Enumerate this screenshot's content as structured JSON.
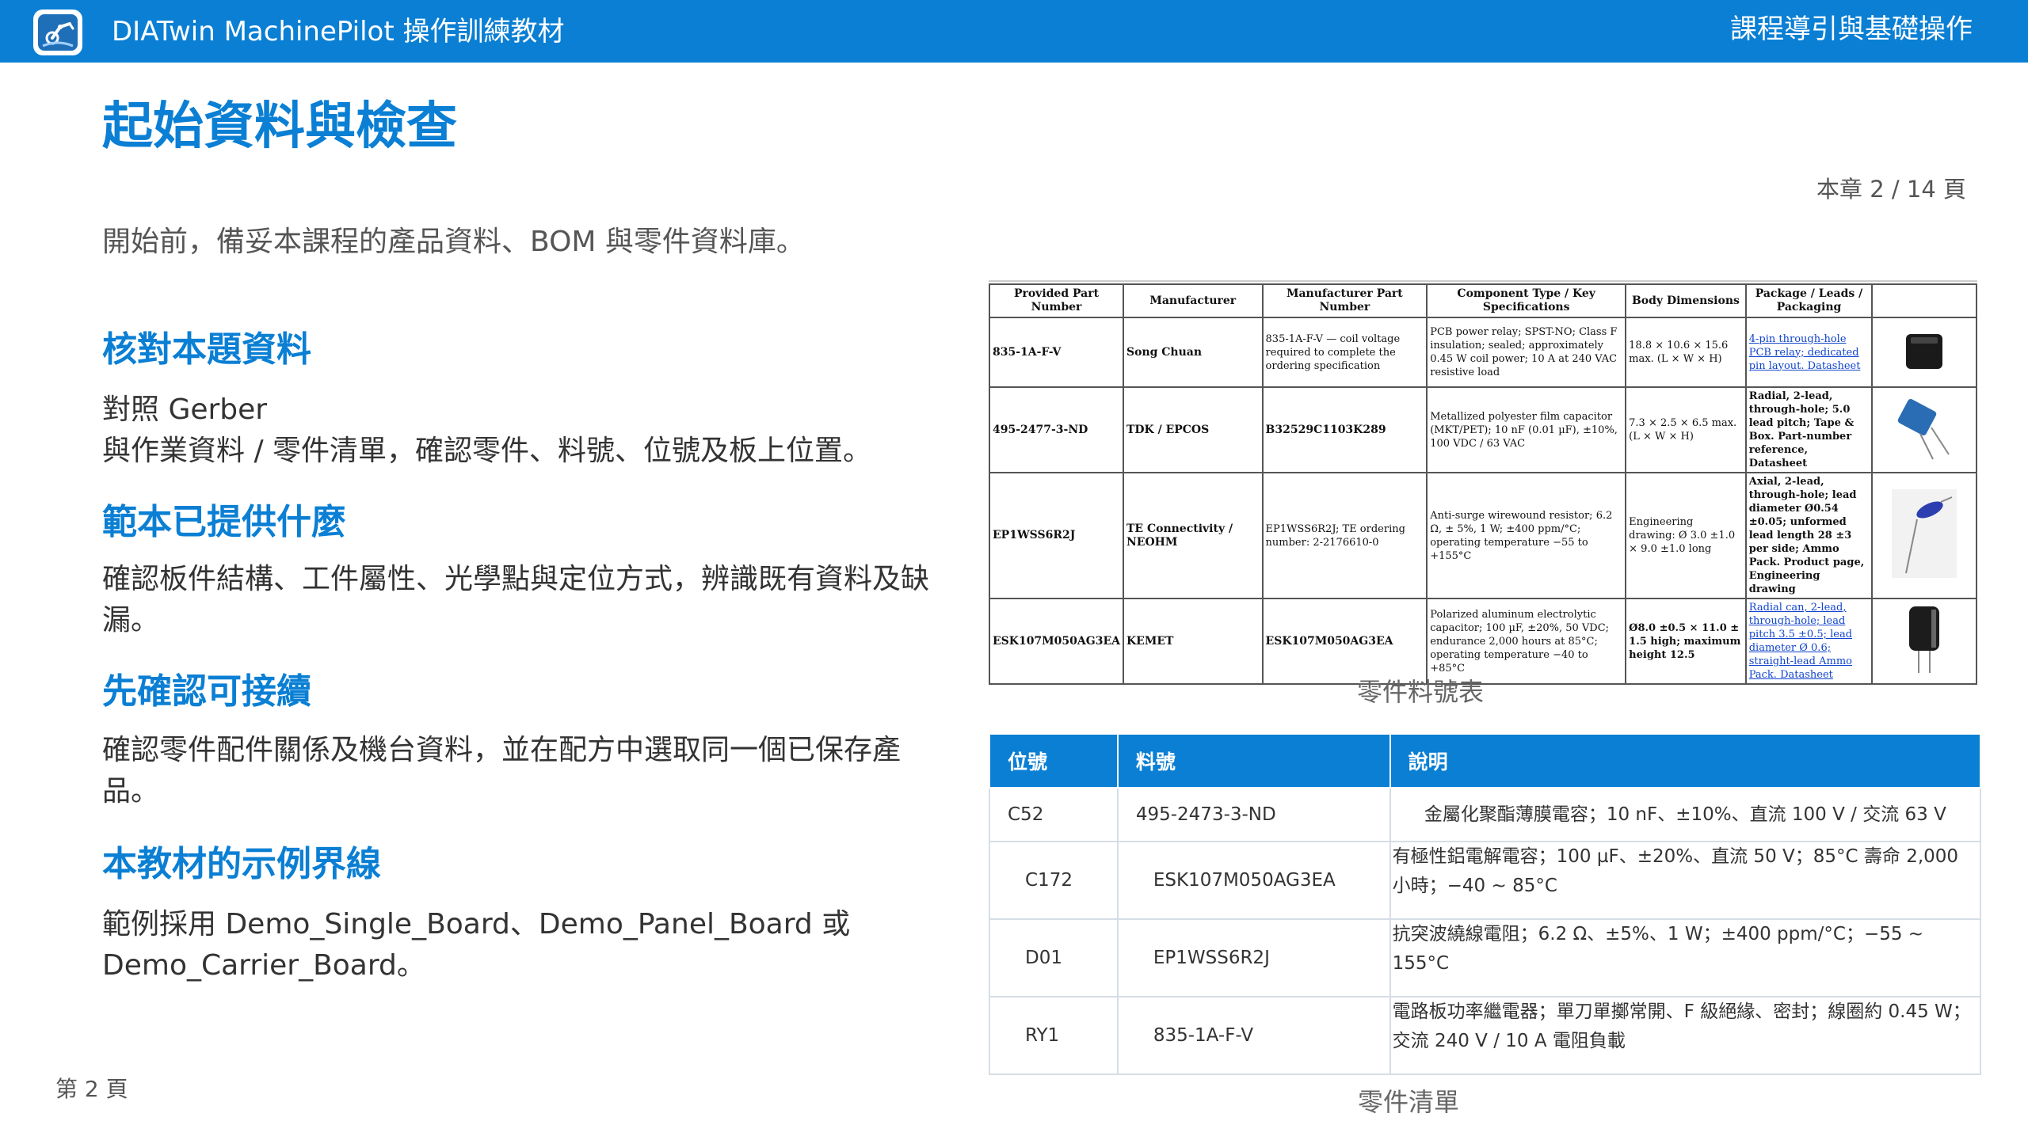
{
  "app": {
    "title": "DIATwin MachinePilot 操作訓練教材",
    "section_label": "課程導引與基礎操作",
    "icon": "robot-arm-icon",
    "accent_color": "#0a7fd4"
  },
  "page": {
    "title": "起始資料與檢查",
    "chapter_indicator": "本章 2 / 14 頁",
    "intro": "開始前，備妥本課程的產品資料、BOM 與零件資料庫。",
    "footer": "第 2 頁"
  },
  "sections": [
    {
      "heading": "核對本題資料",
      "body_line1": "對照 Gerber",
      "body_rest": "與作業資料 / 零件清單，確認零件、料號、位號及板上位置。"
    },
    {
      "heading": "範本已提供什麼",
      "body": "確認板件結構、工件屬性、光學點與定位方式，辨識既有資料及缺漏。"
    },
    {
      "heading": "先確認可接續",
      "body": "確認零件配件關係及機台資料，並在配方中選取同一個已保存產品。"
    },
    {
      "heading": "本教材的示例界線",
      "body": "範例採用 Demo_Single_Board、Demo_Panel_Board 或 Demo_Carrier_Board。"
    }
  ],
  "datasheet": {
    "caption": "零件料號表",
    "headers": [
      "Provided Part Number",
      "Manufacturer",
      "Manufacturer Part Number",
      "Component Type / Key Specifications",
      "Body Dimensions",
      "Package / Leads / Packaging"
    ],
    "rows": [
      {
        "pn": "835-1A-F-V",
        "mfr": "Song Chuan",
        "mpn": "835-1A-F-V — coil voltage required to complete the ordering specification",
        "spec": "PCB power relay; SPST-NO; Class F insulation; sealed; approximately 0.45 W coil power; 10 A at 240 VAC resistive load",
        "dims": "18.8 × 10.6 × 15.6 max. (L × W × H)",
        "pkg": "4-pin through-hole PCB relay; dedicated pin layout. Datasheet",
        "icon": "relay-icon"
      },
      {
        "pn": "495-2477-3-ND",
        "mfr": "TDK / EPCOS",
        "mpn": "B32529C1103K289",
        "spec": "Metallized polyester film capacitor (MKT/PET); 10 nF (0.01 µF), ±10%, 100 VDC / 63 VAC",
        "dims": "7.3 × 2.5 × 6.5 max. (L × W × H)",
        "pkg": "Radial, 2-lead, through-hole; 5.0 lead pitch; Tape & Box. Part-number reference, Datasheet",
        "icon": "film-capacitor-icon"
      },
      {
        "pn": "EP1WSS6R2J",
        "mfr": "TE Connectivity / NEOHM",
        "mpn": "EP1WSS6R2J; TE ordering number: 2-2176610-0",
        "spec": "Anti-surge wirewound resistor; 6.2 Ω, ± 5%, 1 W; ±400 ppm/°C; operating temperature −55 to +155°C",
        "dims": "Engineering drawing: Ø 3.0 ±1.0 × 9.0 ±1.0 long",
        "pkg": "Axial, 2-lead, through-hole; lead diameter Ø0.54 ±0.05; unformed lead length 28 ±3 per side; Ammo Pack. Product page, Engineering drawing",
        "icon": "resistor-icon"
      },
      {
        "pn": "ESK107M050AG3EA",
        "mfr": "KEMET",
        "mpn": "ESK107M050AG3EA",
        "spec": "Polarized aluminum electrolytic capacitor; 100 µF, ±20%, 50 VDC; endurance 2,000 hours at 85°C; operating temperature −40 to +85°C",
        "dims": "Ø8.0 ±0.5 × 11.0 ± 1.5 high; maximum height 12.5",
        "pkg": "Radial can, 2-lead, through-hole; lead pitch 3.5 ±0.5; lead diameter Ø 0.6; straight-lead Ammo Pack. Datasheet",
        "icon": "electrolytic-capacitor-icon"
      }
    ]
  },
  "parts_list": {
    "caption": "零件清單",
    "headers": [
      "位號",
      "料號",
      "說明"
    ],
    "rows": [
      {
        "ref": "C52",
        "part": "495-2473-3-ND",
        "desc": "金屬化聚酯薄膜電容；10 nF、±10%、直流 100 V / 交流 63 V"
      },
      {
        "ref": "C172",
        "part": "ESK107M050AG3EA",
        "desc": "有極性鋁電解電容；100 µF、±20%、直流 50 V；85°C 壽命 2,000 小時；−40 ~ 85°C"
      },
      {
        "ref": "D01",
        "part": "EP1WSS6R2J",
        "desc": "抗突波繞線電阻；6.2 Ω、±5%、1 W；±400 ppm/°C；−55 ~ 155°C"
      },
      {
        "ref": "RY1",
        "part": "835-1A-F-V",
        "desc": "電路板功率繼電器；單刀單擲常開、F 級絕緣、密封；線圈約 0.45 W；交流 240 V / 10 A 電阻負載"
      }
    ]
  }
}
